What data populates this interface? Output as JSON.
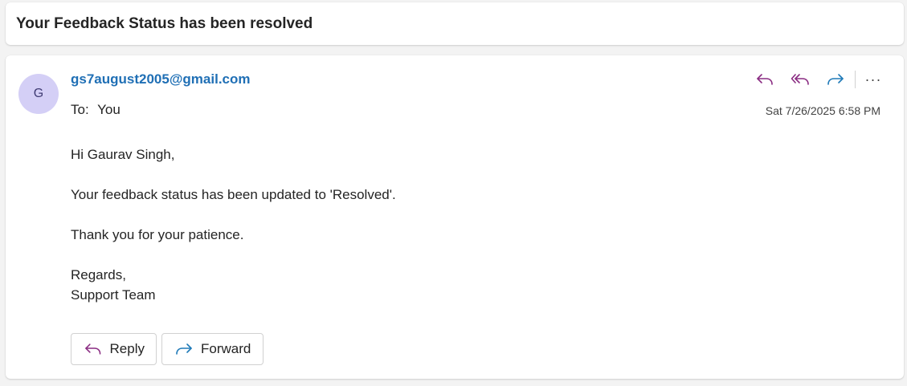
{
  "subject": "Your Feedback Status has been resolved",
  "sender": {
    "initial": "G",
    "email": "gs7august2005@gmail.com",
    "avatar_color": "#d4cff6"
  },
  "to": {
    "label": "To:",
    "value": "You"
  },
  "timestamp": "Sat 7/26/2025 6:58 PM",
  "toolbar_icons": [
    "reply-icon",
    "reply-all-icon",
    "forward-icon",
    "more-icon"
  ],
  "more_glyph": "···",
  "body": {
    "greeting": "Hi Gaurav Singh,",
    "line1": "Your feedback status has been updated to 'Resolved'.",
    "line2": "Thank you for your patience.",
    "closing": "Regards,",
    "signature": "Support Team"
  },
  "buttons": {
    "reply": "Reply",
    "forward": "Forward"
  },
  "colors": {
    "reply_icon": "#8a2c82",
    "forward_icon": "#1f7ab8",
    "sender_link": "#1f6fb5"
  }
}
